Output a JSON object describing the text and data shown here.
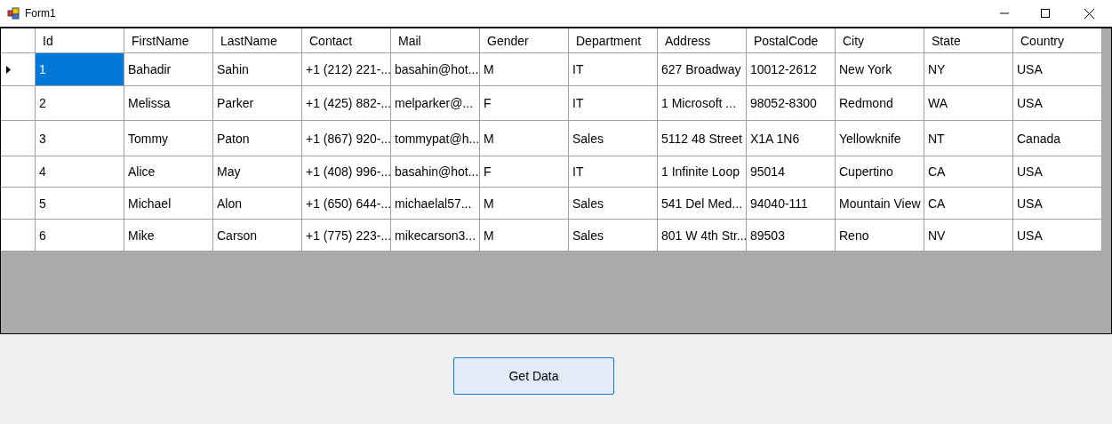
{
  "window": {
    "title": "Form1"
  },
  "table": {
    "columns": [
      "Id",
      "FirstName",
      "LastName",
      "Contact",
      "Mail",
      "Gender",
      "Department",
      "Address",
      "PostalCode",
      "City",
      "State",
      "Country"
    ],
    "rows": [
      {
        "selected": true,
        "cells": [
          "1",
          "Bahadir",
          "Sahin",
          "+1 (212) 221-...",
          "basahin@hot...",
          "M",
          "IT",
          "627 Broadway",
          "10012-2612",
          "New York",
          "NY",
          "USA"
        ]
      },
      {
        "selected": false,
        "cells": [
          "2",
          "Melissa",
          "Parker",
          "+1 (425) 882-...",
          "melparker@...",
          "F",
          "IT",
          "1 Microsoft ...",
          "98052-8300",
          "Redmond",
          "WA",
          "USA"
        ]
      },
      {
        "selected": false,
        "cells": [
          "3",
          "Tommy",
          "Paton",
          "+1 (867) 920-...",
          "tommypat@h...",
          "M",
          "Sales",
          "5112 48 Street",
          "X1A 1N6",
          "Yellowknife",
          "NT",
          "Canada"
        ]
      },
      {
        "selected": false,
        "cells": [
          "4",
          "Alice",
          "May",
          "+1 (408) 996-...",
          "basahin@hot...",
          "F",
          "IT",
          "1 Infinite Loop",
          "95014",
          "Cupertino",
          "CA",
          "USA"
        ]
      },
      {
        "selected": false,
        "cells": [
          "5",
          "Michael",
          "Alon",
          "+1 (650) 644-...",
          "michaelal57...",
          "M",
          "Sales",
          "541 Del Med...",
          "94040-111",
          "Mountain View",
          "CA",
          "USA"
        ]
      },
      {
        "selected": false,
        "cells": [
          "6",
          "Mike",
          "Carson",
          "+1 (775) 223-...",
          "mikecarson3...",
          "M",
          "Sales",
          "801 W 4th Str...",
          "89503",
          "Reno",
          "NV",
          "USA"
        ]
      }
    ]
  },
  "buttons": [
    "Get Data"
  ]
}
